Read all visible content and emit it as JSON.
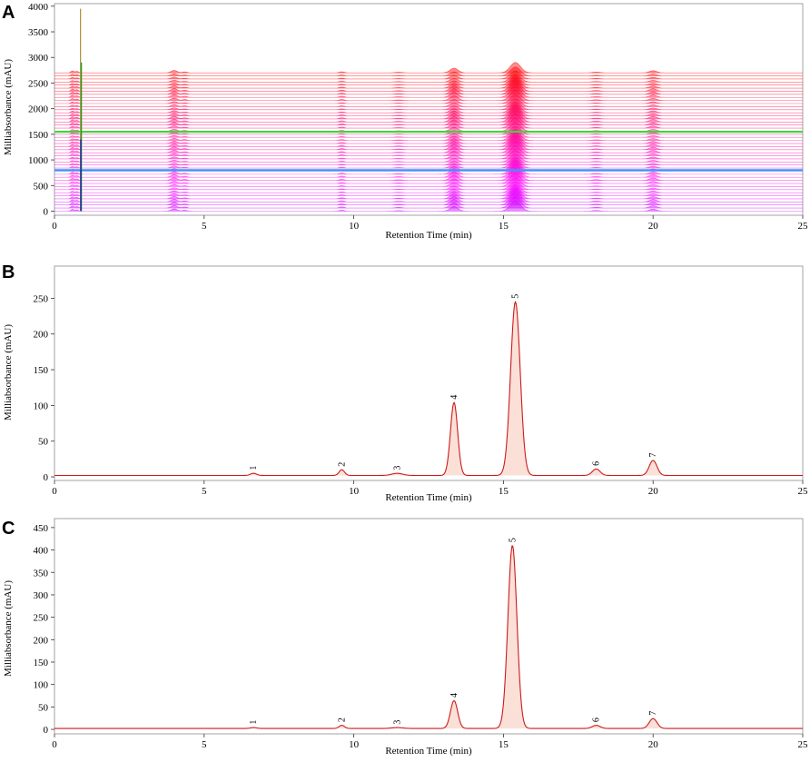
{
  "chart_data": [
    {
      "panel": "A",
      "type": "line",
      "xlabel": "Retention Time (min)",
      "ylabel": "Milliabsorbance (mAU)",
      "xlim": [
        0,
        25
      ],
      "ylim": [
        -80,
        4050
      ],
      "x_ticks": [
        0,
        5,
        10,
        15,
        20,
        25
      ],
      "y_ticks": [
        0,
        500,
        1000,
        1500,
        2000,
        2500,
        3000,
        3500,
        4000
      ],
      "stack": {
        "traces": 46,
        "offset_step": 60,
        "first_color": "#cc00ff",
        "last_color": "#ff2a2a"
      },
      "peaks": [
        {
          "rt": 0.6,
          "height": 40,
          "width": 0.05
        },
        {
          "rt": 0.75,
          "height": 30,
          "width": 0.05
        },
        {
          "rt": 4.0,
          "height": 50,
          "width": 0.1
        },
        {
          "rt": 4.35,
          "height": 20,
          "width": 0.08
        },
        {
          "rt": 9.6,
          "height": 22,
          "width": 0.08
        },
        {
          "rt": 11.5,
          "height": 12,
          "width": 0.12
        },
        {
          "rt": 13.35,
          "height": 100,
          "width": 0.13
        },
        {
          "rt": 15.4,
          "height": 220,
          "width": 0.17
        },
        {
          "rt": 18.1,
          "height": 15,
          "width": 0.12
        },
        {
          "rt": 20.0,
          "height": 45,
          "width": 0.12
        }
      ],
      "solvent_spikes": [
        {
          "x": 0.87,
          "top": 3950,
          "color": "#a98d3a"
        },
        {
          "x": 0.9,
          "top": 2900,
          "color": "#1a9d1a"
        },
        {
          "x": 0.88,
          "top": 1400,
          "color": "#1010cc"
        }
      ],
      "highlight_traces": [
        {
          "offset": 1550,
          "color": "#33dd33"
        },
        {
          "offset": 800,
          "color": "#2a9dff"
        }
      ]
    },
    {
      "panel": "B",
      "type": "line",
      "xlabel": "Retention Time (min)",
      "ylabel": "Milliabsorbance (mAU)",
      "xlim": [
        0,
        25
      ],
      "ylim": [
        -5,
        295
      ],
      "x_ticks": [
        0,
        5,
        10,
        15,
        20,
        25
      ],
      "y_ticks": [
        0,
        50,
        100,
        150,
        200,
        250
      ],
      "baseline": 2,
      "color": "#cc1a1a",
      "fill": "#fbe0d8",
      "peaks": [
        {
          "label": "1",
          "rt": 6.65,
          "height": 3,
          "width": 0.1
        },
        {
          "label": "2",
          "rt": 9.6,
          "height": 8,
          "width": 0.09
        },
        {
          "label": "3",
          "rt": 11.45,
          "height": 3,
          "width": 0.18
        },
        {
          "label": "4",
          "rt": 13.35,
          "height": 102,
          "width": 0.12
        },
        {
          "label": "5",
          "rt": 15.4,
          "height": 243,
          "width": 0.16
        },
        {
          "label": "6",
          "rt": 18.1,
          "height": 9,
          "width": 0.13
        },
        {
          "label": "7",
          "rt": 20.0,
          "height": 21,
          "width": 0.13
        }
      ]
    },
    {
      "panel": "C",
      "type": "line",
      "xlabel": "Retention Time (min)",
      "ylabel": "Milliabsorbance (mAU)",
      "xlim": [
        0,
        25
      ],
      "ylim": [
        -10,
        470
      ],
      "x_ticks": [
        0,
        5,
        10,
        15,
        20,
        25
      ],
      "y_ticks": [
        0,
        50,
        100,
        150,
        200,
        250,
        300,
        350,
        400,
        450
      ],
      "baseline": 2,
      "color": "#cc1a1a",
      "fill": "#fbe0d8",
      "peaks": [
        {
          "label": "1",
          "rt": 6.65,
          "height": 2,
          "width": 0.1
        },
        {
          "label": "2",
          "rt": 9.6,
          "height": 7,
          "width": 0.09
        },
        {
          "label": "3",
          "rt": 11.45,
          "height": 2,
          "width": 0.18
        },
        {
          "label": "4",
          "rt": 13.35,
          "height": 62,
          "width": 0.12
        },
        {
          "label": "5",
          "rt": 15.3,
          "height": 408,
          "width": 0.15
        },
        {
          "label": "6",
          "rt": 18.1,
          "height": 7,
          "width": 0.13
        },
        {
          "label": "7",
          "rt": 20.0,
          "height": 22,
          "width": 0.13
        }
      ]
    }
  ]
}
